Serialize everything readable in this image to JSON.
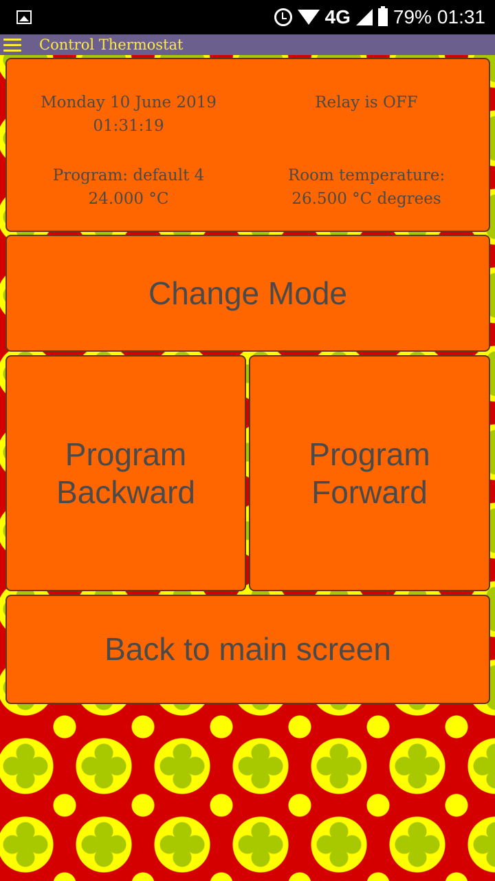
{
  "status_bar": {
    "icons": [
      "image-icon",
      "alarm-icon",
      "wifi-icon",
      "signal-icon",
      "battery-icon"
    ],
    "network": "4G",
    "battery": "79%",
    "time": "01:31"
  },
  "app_bar": {
    "title": "Control Thermostat",
    "menu_icon": "hamburger-menu-icon"
  },
  "info": {
    "datetime": "Monday 10 June 2019 01:31:19",
    "relay_status": "Relay is OFF",
    "program": "Program: default 4\n24.000 °C",
    "room_temperature": "Room temperature:\n26.500 °C degrees"
  },
  "buttons": {
    "change_mode": "Change Mode",
    "program_backward": "Program\nBackward",
    "program_forward": "Program\nForward",
    "back_to_main": "Back to main screen"
  },
  "colors": {
    "panel": "#ff6600",
    "app_bar": "#6b5f8e",
    "app_title": "#ffeb3b",
    "text": "#4a4a4a",
    "pattern_red": "#d40000",
    "pattern_yellow": "#ffff00",
    "pattern_green": "#a8c800"
  }
}
